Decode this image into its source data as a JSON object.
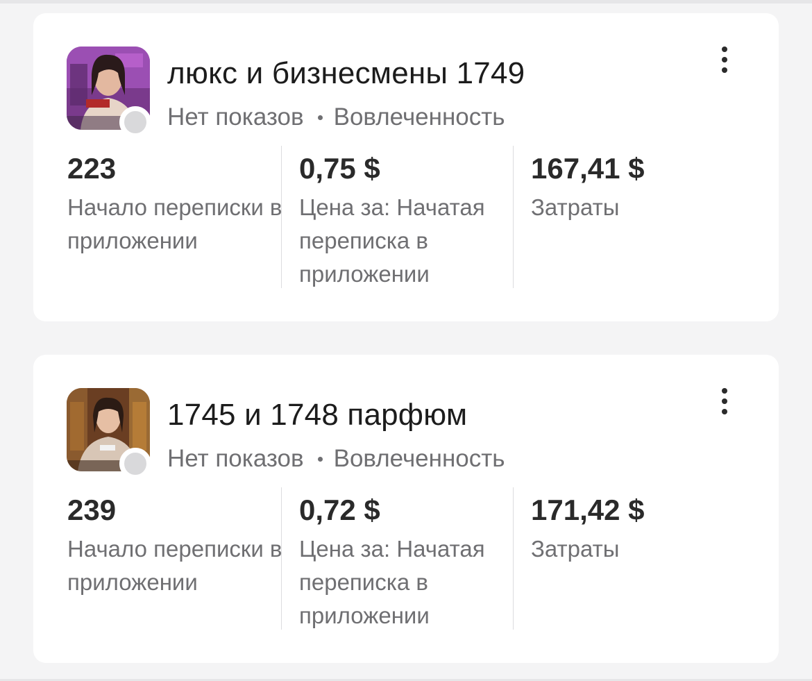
{
  "campaigns": [
    {
      "title": "люкс и бизнесмены 1749",
      "status": "Нет показов",
      "separator": "•",
      "objective": "Вовлеченность",
      "thumbnail_icon": "ad-creative-thumbnail",
      "metrics": [
        {
          "value": "223",
          "label": "Начало переписки в приложении"
        },
        {
          "value": "0,75 $",
          "label": "Цена за: Начатая переписка в приложении"
        },
        {
          "value": "167,41 $",
          "label": "Затраты"
        }
      ]
    },
    {
      "title": "1745 и 1748 парфюм",
      "status": "Нет показов",
      "separator": "•",
      "objective": "Вовлеченность",
      "thumbnail_icon": "ad-creative-thumbnail",
      "metrics": [
        {
          "value": "239",
          "label": "Начало переписки в приложении"
        },
        {
          "value": "0,72 $",
          "label": "Цена за: Начатая переписка в приложении"
        },
        {
          "value": "171,42 $",
          "label": "Затраты"
        }
      ]
    }
  ],
  "colors": {
    "background": "#f4f4f5",
    "card": "#ffffff",
    "title": "#1c1c1c",
    "secondary_text": "#6f6f72",
    "value_text": "#2a2a2a",
    "status_dot_inactive": "#d9d9db"
  }
}
